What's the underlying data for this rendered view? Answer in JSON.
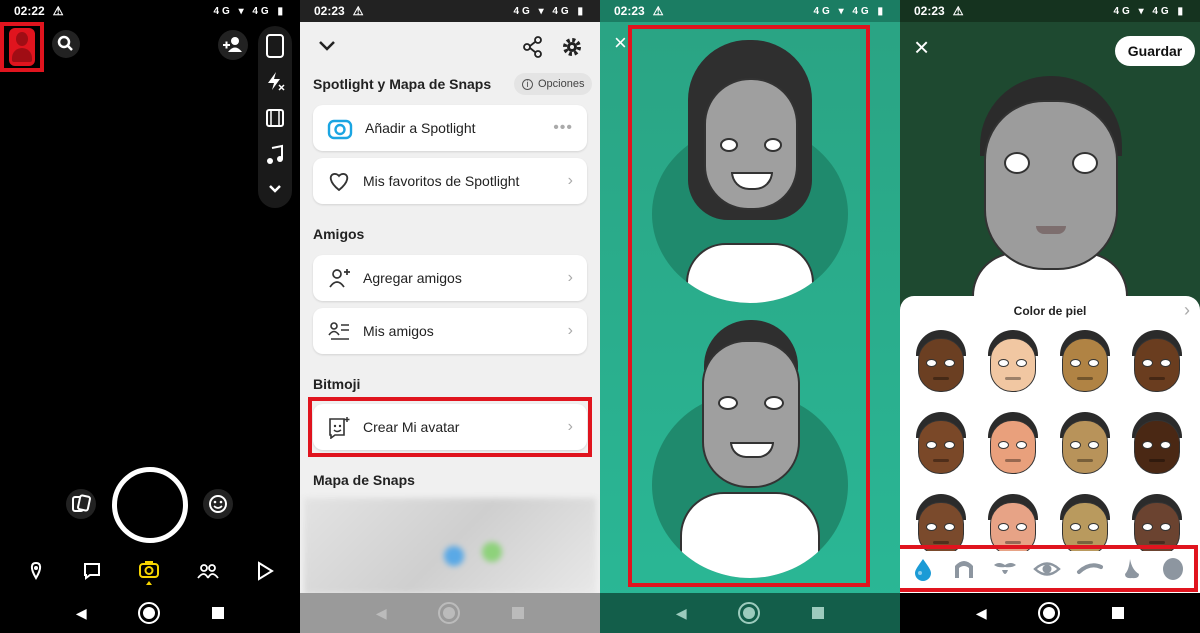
{
  "panel1": {
    "time": "02:22",
    "status_icons": "4G ▾ 4G ▮",
    "colors": {
      "highlight": "#e0141e",
      "capture_active": "#f7d500"
    },
    "icons": {
      "avatar": "avatar-icon",
      "search": "search-icon",
      "add_friend": "add-friend-icon",
      "flip": "flip-camera-icon",
      "flash": "flash-off-icon",
      "video": "video-icon",
      "music": "music-icon",
      "more": "chevron-down-icon",
      "memories": "memories-icon",
      "lens": "lens-icon",
      "map": "map-icon",
      "chat": "chat-icon",
      "camera": "camera-icon",
      "stories": "stories-icon",
      "spotlight": "spotlight-icon"
    }
  },
  "panel2": {
    "time": "02:23",
    "status_icons": "4G ▾ 4G ▮",
    "section_spotlight": "Spotlight y Mapa de Snaps",
    "options_label": "Opciones",
    "add_spotlight": "Añadir a Spotlight",
    "favorites": "Mis favoritos de Spotlight",
    "section_friends": "Amigos",
    "add_friends": "Agregar amigos",
    "my_friends": "Mis amigos",
    "section_bitmoji": "Bitmoji",
    "create_avatar": "Crear Mi avatar",
    "section_map": "Mapa de Snaps"
  },
  "panel3": {
    "time": "02:23",
    "status_icons": "4G ▾ 4G ▮",
    "close": "×"
  },
  "panel4": {
    "time": "02:23",
    "status_icons": "4G ▾ 4G ▮",
    "save_label": "Guardar",
    "close": "×",
    "skin_title": "Color de piel",
    "skin_tones": [
      "#6b3f22",
      "#f1c7a2",
      "#b08344",
      "#6a3d1f",
      "#7a4828",
      "#e9a07c",
      "#b8935a",
      "#4a2814",
      "#7a4a2c",
      "#e7a386",
      "#b99a5e",
      "#6b4330"
    ],
    "categories": [
      "skin-tone-icon",
      "hair-icon",
      "facial-hair-icon",
      "eye-icon",
      "eyebrow-icon",
      "nose-icon",
      "head-shape-icon"
    ]
  }
}
